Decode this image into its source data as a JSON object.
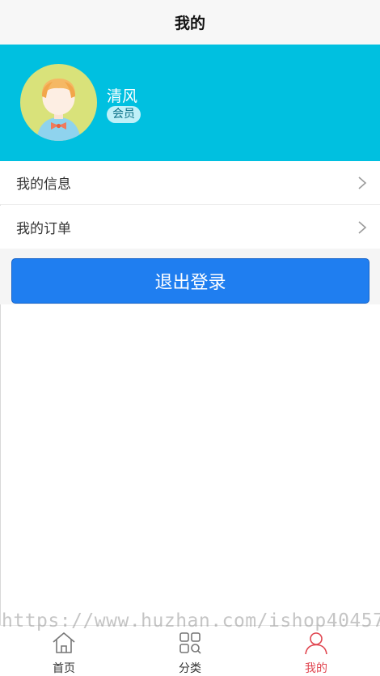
{
  "header": {
    "title": "我的"
  },
  "profile": {
    "name": "清风",
    "badge": "会员",
    "background_color": "#00c0e0"
  },
  "menu": {
    "items": [
      {
        "label": "我的信息"
      },
      {
        "label": "我的订单"
      }
    ]
  },
  "logout": {
    "label": "退出登录",
    "color": "#1f7ef0"
  },
  "watermark": "https://www.huzhan.com/ishop40457",
  "tabbar": {
    "items": [
      {
        "label": "首页",
        "icon": "home-icon"
      },
      {
        "label": "分类",
        "icon": "category-icon"
      },
      {
        "label": "我的",
        "icon": "user-icon",
        "active": true
      }
    ],
    "active_color": "#e0454f"
  }
}
